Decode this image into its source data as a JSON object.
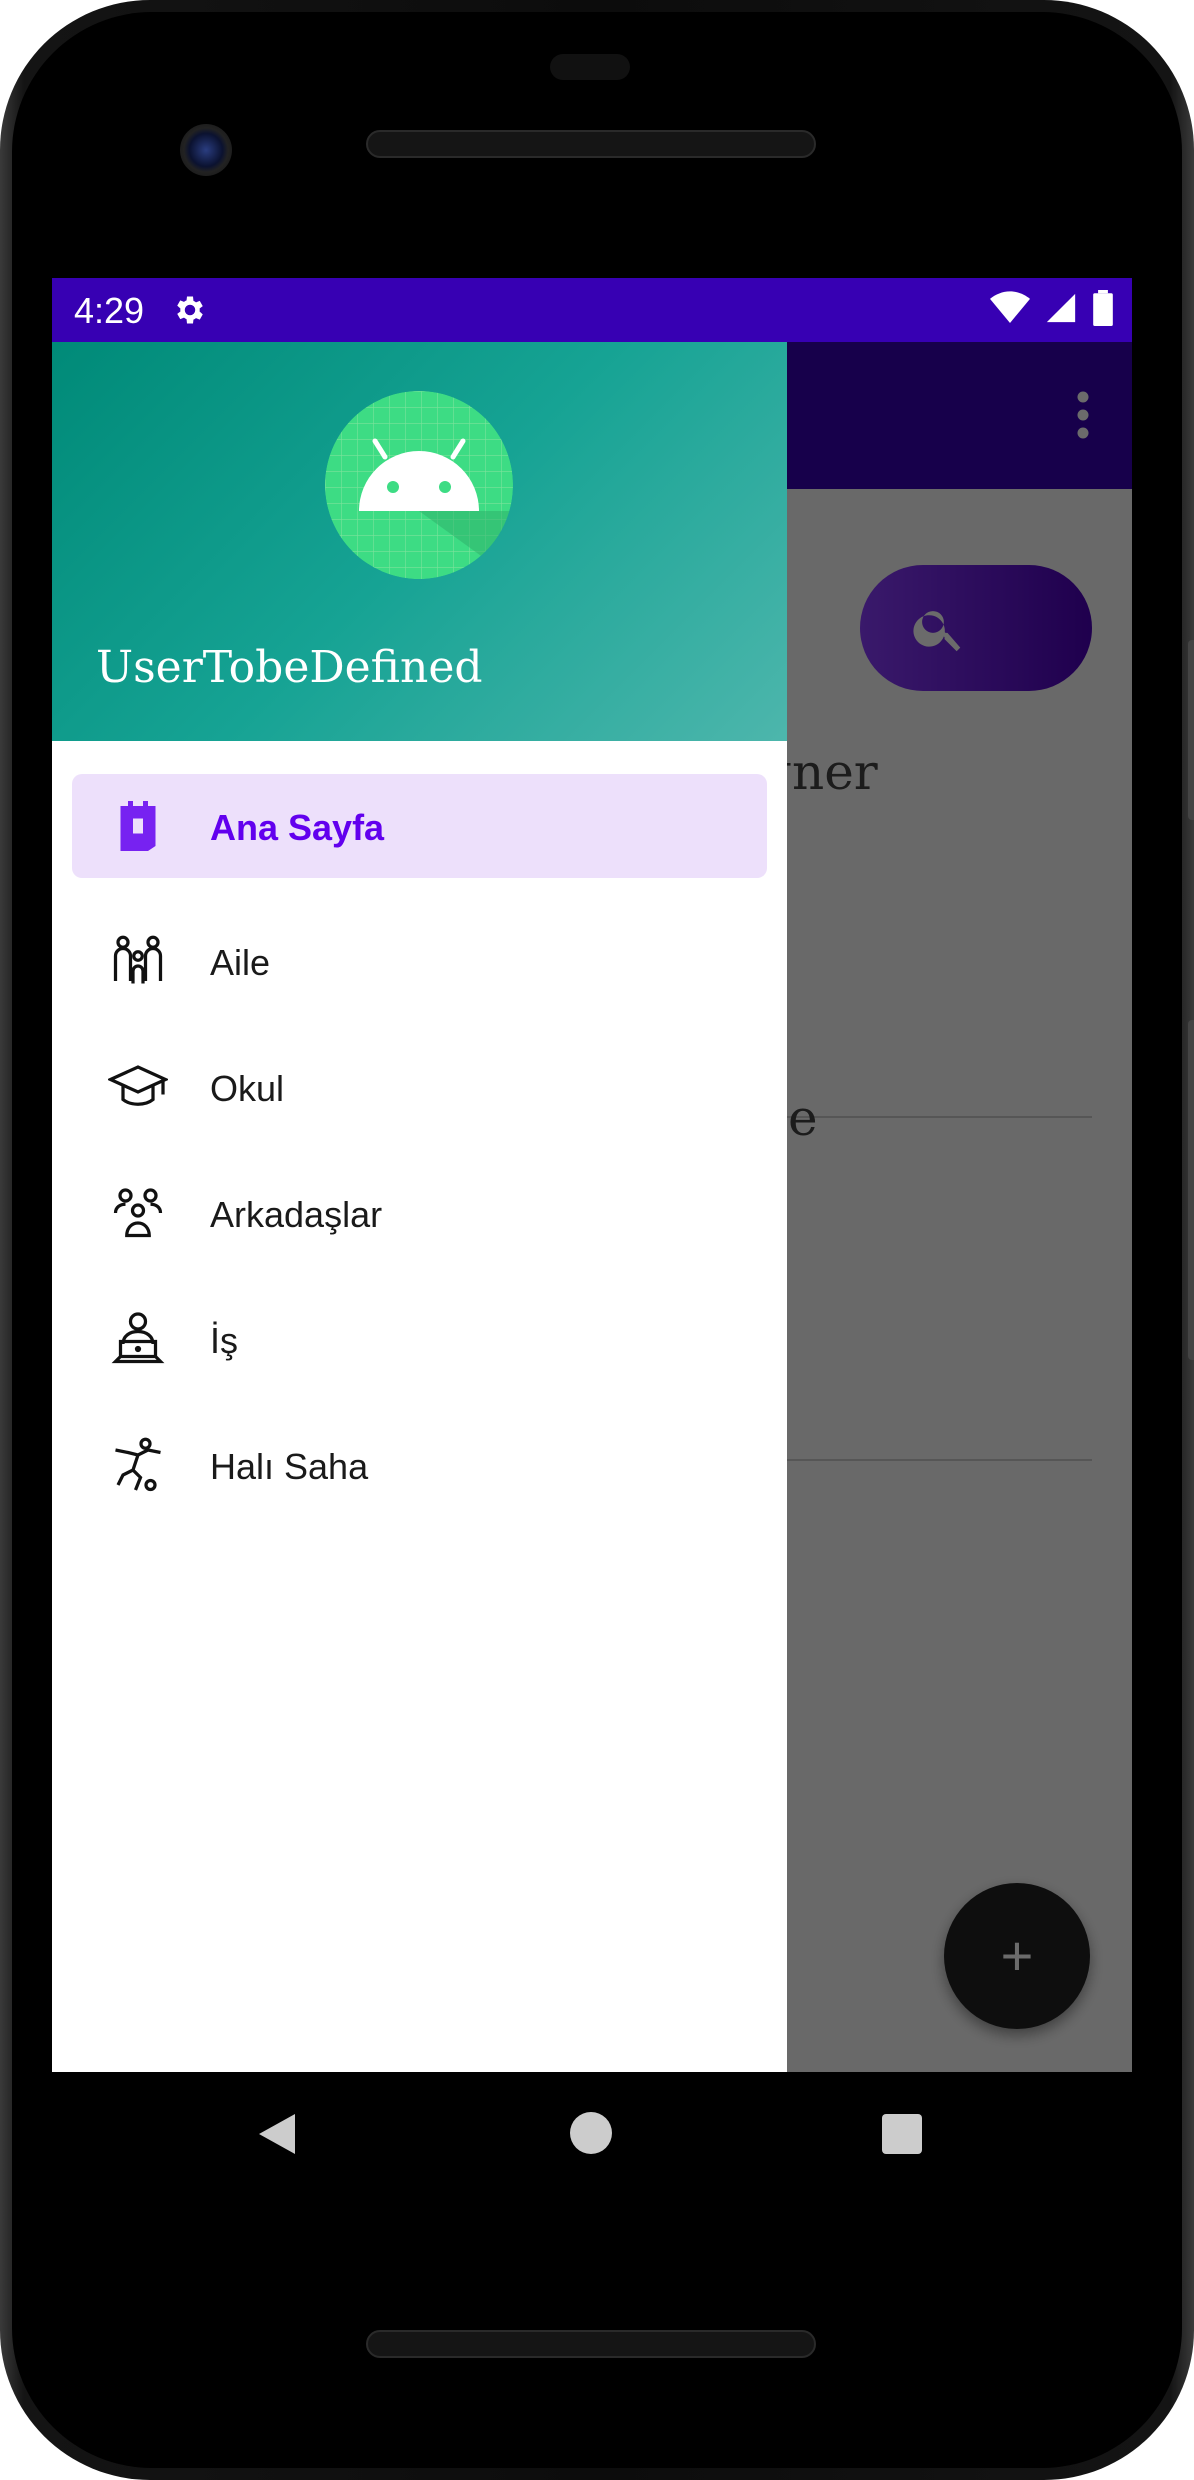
{
  "status_bar": {
    "time": "4:29",
    "icons": [
      "gear-icon",
      "wifi-icon",
      "signal-icon",
      "battery-icon"
    ],
    "color": "#3700b3"
  },
  "app_bar": {
    "color": "#3700b3",
    "menu_icon": "more-vert-icon"
  },
  "background_content": {
    "search_icon": "search-icon",
    "text_1": "gner",
    "text_2": "ce",
    "fab_label": "+"
  },
  "drawer": {
    "header": {
      "user_name": "UserTobeDefined",
      "avatar_icon": "android-icon"
    },
    "items": [
      {
        "label": "Ana Sayfa",
        "icon": "home-icon",
        "selected": true
      },
      {
        "label": "Aile",
        "icon": "family-icon",
        "selected": false
      },
      {
        "label": "Okul",
        "icon": "graduation-cap-icon",
        "selected": false
      },
      {
        "label": "Arkadaşlar",
        "icon": "friends-icon",
        "selected": false
      },
      {
        "label": "İş",
        "icon": "laptop-worker-icon",
        "selected": false
      },
      {
        "label": "Halı Saha",
        "icon": "soccer-player-icon",
        "selected": false
      }
    ],
    "accent_color": "#6200ee"
  },
  "nav_bar": {
    "icons": [
      "back-icon",
      "home-circle-icon",
      "recents-icon"
    ]
  }
}
